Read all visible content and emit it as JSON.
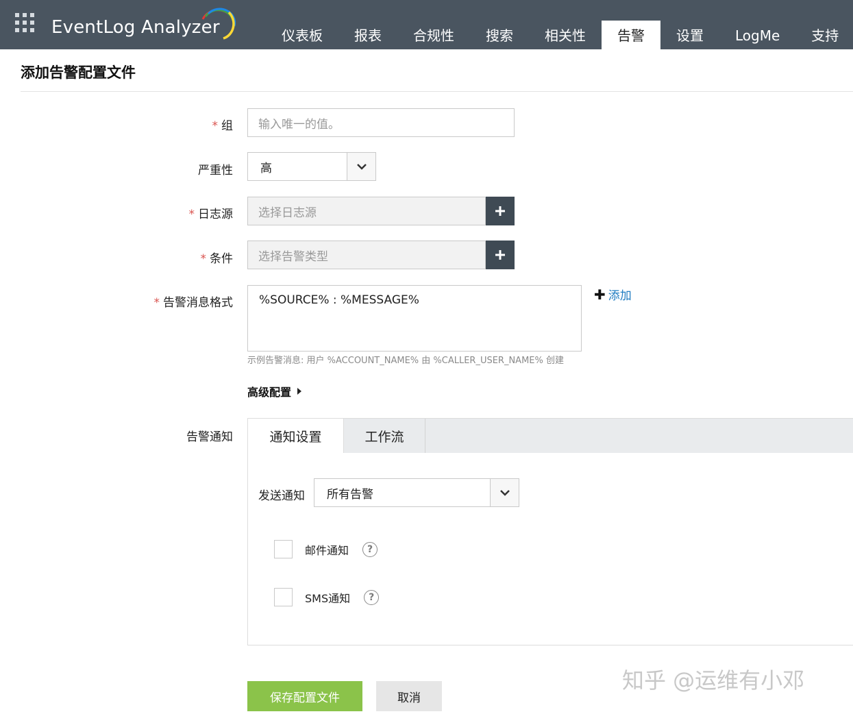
{
  "app": {
    "brand": "EventLog Analyzer",
    "nav": [
      "仪表板",
      "报表",
      "合规性",
      "搜索",
      "相关性",
      "告警",
      "设置",
      "LogMe",
      "支持"
    ],
    "active_nav": "告警"
  },
  "page": {
    "title": "添加告警配置文件"
  },
  "form": {
    "group": {
      "label": "组",
      "placeholder": "输入唯一的值。"
    },
    "severity": {
      "label": "严重性",
      "value": "高"
    },
    "log_source": {
      "label": "日志源",
      "placeholder": "选择日志源"
    },
    "condition": {
      "label": "条件",
      "placeholder": "选择告警类型"
    },
    "message_format": {
      "label": "告警消息格式",
      "value": "%SOURCE% : %MESSAGE%",
      "add_label": "添加",
      "hint": "示例告警消息: 用户 %ACCOUNT_NAME% 由 %CALLER_USER_NAME% 创建"
    },
    "advanced_label": "高级配置",
    "required_mark": "*"
  },
  "notifications": {
    "label": "告警通知",
    "tabs": [
      "通知设置",
      "工作流"
    ],
    "send_label": "发送通知",
    "send_value": "所有告警",
    "email_label": "邮件通知",
    "sms_label": "SMS通知",
    "help_glyph": "?"
  },
  "actions": {
    "save": "保存配置文件",
    "cancel": "取消"
  },
  "watermark": "知乎 @运维有小邓",
  "colors": {
    "topbar": "#4a5560",
    "save_button": "#8bc34a",
    "link": "#1f7cc1",
    "required": "#d9534f"
  }
}
